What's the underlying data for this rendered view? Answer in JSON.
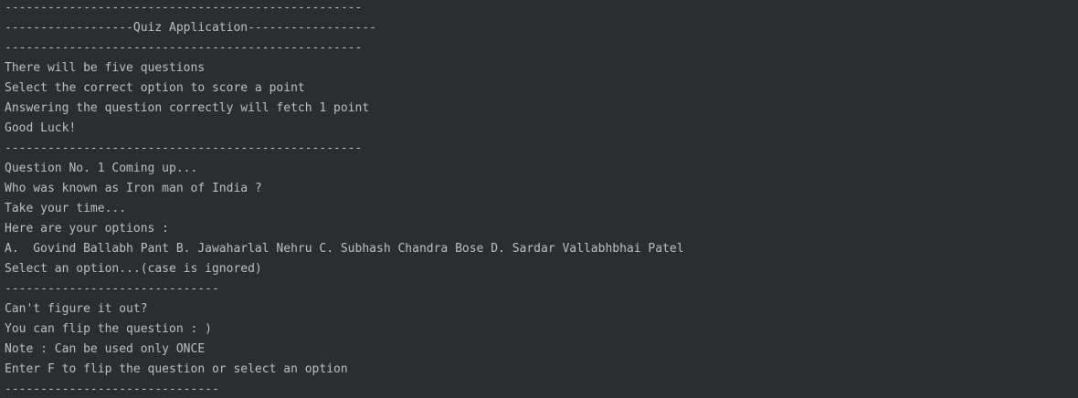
{
  "console": {
    "lines": [
      "--------------------------------------------------",
      "------------------Quiz Application------------------",
      "--------------------------------------------------",
      "There will be five questions",
      "Select the correct option to score a point",
      "Answering the question correctly will fetch 1 point",
      "Good Luck!",
      "--------------------------------------------------",
      "Question No. 1 Coming up...",
      "Who was known as Iron man of India ?",
      "Take your time...",
      "Here are your options :",
      "A.  Govind Ballabh Pant B. Jawaharlal Nehru C. Subhash Chandra Bose D. Sardar Vallabhbhai Patel",
      "Select an option...(case is ignored)",
      "------------------------------",
      "Can't figure it out?",
      "You can flip the question : )",
      "Note : Can be used only ONCE",
      "Enter F to flip the question or select an option",
      "------------------------------"
    ]
  }
}
